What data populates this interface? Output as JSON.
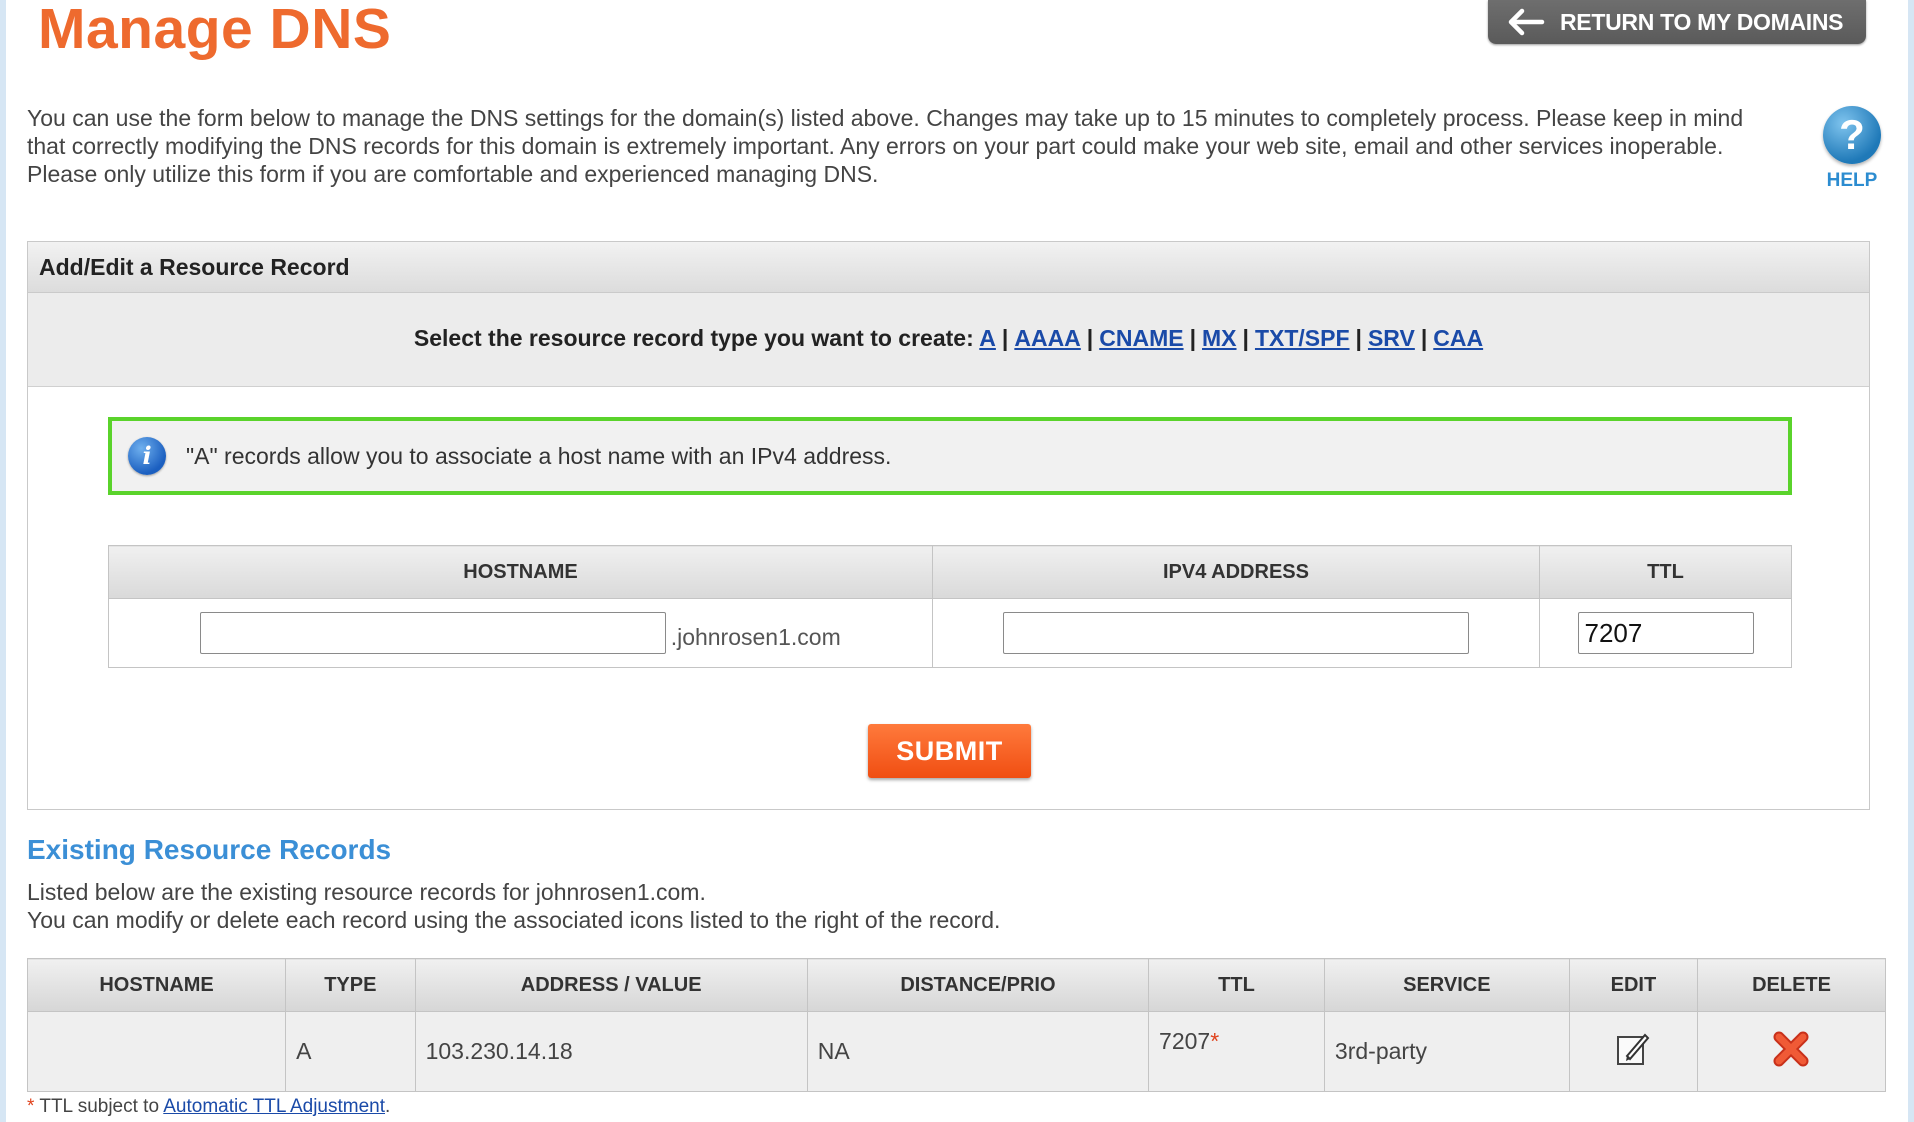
{
  "page": {
    "title": "Manage DNS",
    "return_button": "RETURN TO MY DOMAINS",
    "intro": "You can use the form below to manage the DNS settings for the domain(s) listed above. Changes may take up to 15 minutes to completely process. Please keep in mind that correctly modifying the DNS records for this domain is extremely important. Any errors on your part could make your web site, email and other services inoperable. Please only utilize this form if you are comfortable and experienced managing DNS.",
    "help_label": "HELP",
    "help_glyph": "?"
  },
  "panel": {
    "header": "Add/Edit a Resource Record",
    "type_prompt": "Select the resource record type you want to create:",
    "record_types": [
      "A",
      "AAAA",
      "CNAME",
      "MX",
      "TXT/SPF",
      "SRV",
      "CAA"
    ],
    "info_glyph": "i",
    "info_text": "\"A\" records allow you to associate a host name with an IPv4 address."
  },
  "form": {
    "col_hostname": "HOSTNAME",
    "col_ipv4": "IPV4 ADDRESS",
    "col_ttl": "TTL",
    "hostname_value": "",
    "domain_suffix": ".johnrosen1.com",
    "ipv4_value": "",
    "ttl_value": "7207",
    "submit_label": "SUBMIT"
  },
  "existing": {
    "title": "Existing Resource Records",
    "desc_line1": "Listed below are the existing resource records for johnrosen1.com.",
    "desc_line2": "You can modify or delete each record using the associated icons listed to the right of the record.",
    "headers": [
      "HOSTNAME",
      "TYPE",
      "ADDRESS / VALUE",
      "DISTANCE/PRIO",
      "TTL",
      "SERVICE",
      "EDIT",
      "DELETE"
    ],
    "rows": [
      {
        "hostname": "",
        "type": "A",
        "value": "103.230.14.18",
        "prio": "NA",
        "ttl": "7207",
        "ttl_mark": "*",
        "service": "3rd-party"
      }
    ]
  },
  "footnote": {
    "star": "*",
    "text": " TTL subject to ",
    "link": "Automatic TTL Adjustment",
    "end": "."
  },
  "colors": {
    "title_orange": "#ee6a2e",
    "link_blue": "#1a4aa8",
    "section_blue": "#3b8fd6",
    "info_border_green": "#5ad32b",
    "submit_orange": "#f04e12",
    "delete_red": "#e0421c"
  },
  "icons": {
    "return": "arrow-left-icon",
    "help": "question-icon",
    "info": "info-icon",
    "edit": "pencil-edit-icon",
    "delete": "red-x-icon"
  }
}
